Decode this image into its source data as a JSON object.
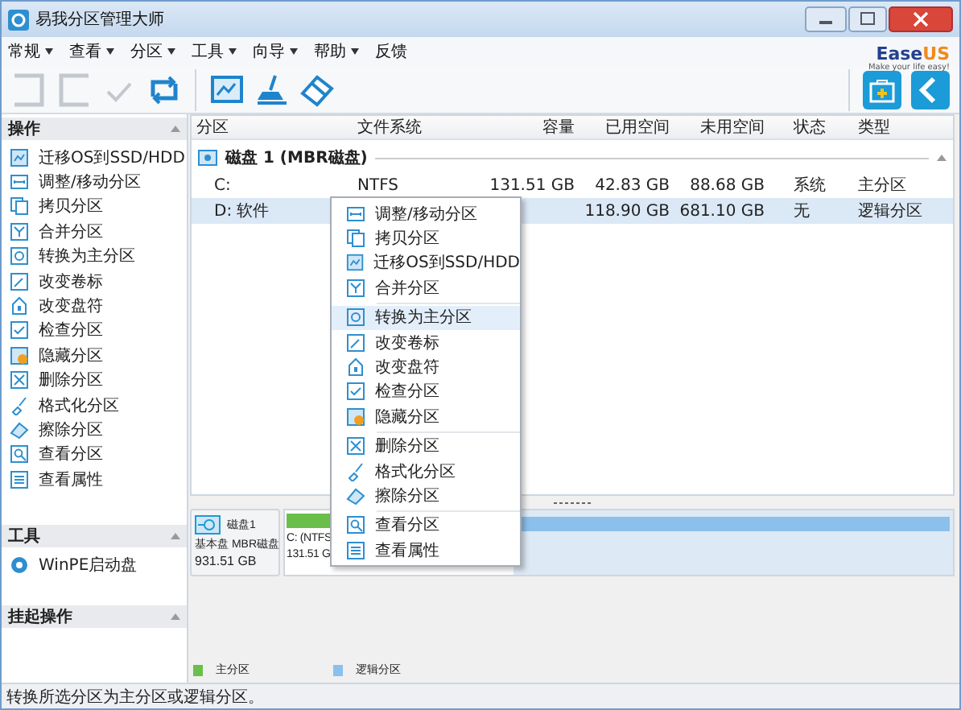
{
  "window": {
    "title": "易我分区管理大师"
  },
  "menu": [
    {
      "label": "常规",
      "has_dropdown": true
    },
    {
      "label": "查看",
      "has_dropdown": true
    },
    {
      "label": "分区",
      "has_dropdown": true
    },
    {
      "label": "工具",
      "has_dropdown": true
    },
    {
      "label": "向导",
      "has_dropdown": true
    },
    {
      "label": "帮助",
      "has_dropdown": true
    },
    {
      "label": "反馈",
      "has_dropdown": false
    }
  ],
  "logo": {
    "brand": "Ease",
    "brand_accent": "US",
    "tagline": "Make your life easy!"
  },
  "toolbar": [
    {
      "kind": "undo",
      "disabled": true
    },
    {
      "kind": "redo",
      "disabled": true
    },
    {
      "kind": "check",
      "disabled": true
    },
    {
      "kind": "apply",
      "disabled": false
    },
    {
      "kind": "migrate",
      "disabled": false
    },
    {
      "kind": "cleanup",
      "disabled": false
    },
    {
      "kind": "eraser",
      "disabled": false
    }
  ],
  "toolbar_right": [
    {
      "kind": "toolkit"
    },
    {
      "kind": "back"
    }
  ],
  "sidebar": {
    "sections": [
      {
        "title": "操作",
        "items": [
          {
            "label": "迁移OS到SSD/HDD",
            "kind": "migrate"
          },
          {
            "label": "调整/移动分区",
            "kind": "resize"
          },
          {
            "label": "拷贝分区",
            "kind": "copy"
          },
          {
            "label": "合并分区",
            "kind": "merge"
          },
          {
            "label": "转换为主分区",
            "kind": "convert"
          },
          {
            "label": "改变卷标",
            "kind": "label"
          },
          {
            "label": "改变盘符",
            "kind": "letter"
          },
          {
            "label": "检查分区",
            "kind": "check"
          },
          {
            "label": "隐藏分区",
            "kind": "hide"
          },
          {
            "label": "删除分区",
            "kind": "delete"
          },
          {
            "label": "格式化分区",
            "kind": "format"
          },
          {
            "label": "擦除分区",
            "kind": "wipe"
          },
          {
            "label": "查看分区",
            "kind": "view"
          },
          {
            "label": "查看属性",
            "kind": "props"
          }
        ]
      },
      {
        "title": "工具",
        "items": [
          {
            "label": "WinPE启动盘",
            "kind": "winpe"
          }
        ]
      },
      {
        "title": "挂起操作"
      }
    ]
  },
  "table": {
    "columns": [
      "分区",
      "文件系统",
      "容量",
      "已用空间",
      "未用空间",
      "状态",
      "类型"
    ],
    "disk": {
      "label": "磁盘 1 (MBR磁盘)"
    },
    "rows": [
      {
        "cells": [
          "C:",
          "NTFS",
          "131.51 GB",
          "42.83 GB",
          "88.68 GB",
          "系统",
          "主分区"
        ],
        "selected": false
      },
      {
        "cells": [
          "D: 软件",
          null,
          null,
          "118.90 GB",
          "681.10 GB",
          "无",
          "逻辑分区"
        ],
        "selected": true
      }
    ]
  },
  "context_menu": {
    "groups": [
      [
        {
          "label": "调整/移动分区",
          "kind": "resize",
          "selected": false
        },
        {
          "label": "拷贝分区",
          "kind": "copy",
          "selected": false
        },
        {
          "label": "迁移OS到SSD/HDD",
          "kind": "migrate",
          "selected": false
        },
        {
          "label": "合并分区",
          "kind": "merge",
          "selected": false
        }
      ],
      [
        {
          "label": "转换为主分区",
          "kind": "convert",
          "selected": true
        },
        {
          "label": "改变卷标",
          "kind": "label",
          "selected": false
        },
        {
          "label": "改变盘符",
          "kind": "letter",
          "selected": false
        },
        {
          "label": "检查分区",
          "kind": "check",
          "selected": false
        },
        {
          "label": "隐藏分区",
          "kind": "hide",
          "selected": false
        }
      ],
      [
        {
          "label": "删除分区",
          "kind": "delete",
          "selected": false
        },
        {
          "label": "格式化分区",
          "kind": "format",
          "selected": false
        },
        {
          "label": "擦除分区",
          "kind": "wipe",
          "selected": false
        }
      ],
      [
        {
          "label": "查看分区",
          "kind": "view",
          "selected": false
        },
        {
          "label": "查看属性",
          "kind": "props",
          "selected": false
        }
      ]
    ]
  },
  "disk_map": {
    "disk": {
      "name": "磁盘1",
      "type": "基本盘 MBR磁盘",
      "size": "931.51 GB"
    },
    "partitions": [
      {
        "kind": "primary",
        "label": "C: (NTFS",
        "size": "131.51 G",
        "selected": false
      },
      {
        "kind": "logical",
        "selected": true
      }
    ]
  },
  "legend": [
    {
      "label": "主分区",
      "color": "#6abf4b"
    },
    {
      "label": "逻辑分区",
      "color": "#8cc0ec"
    }
  ],
  "status_bar": {
    "text": "转换所选分区为主分区或逻辑分区。"
  }
}
